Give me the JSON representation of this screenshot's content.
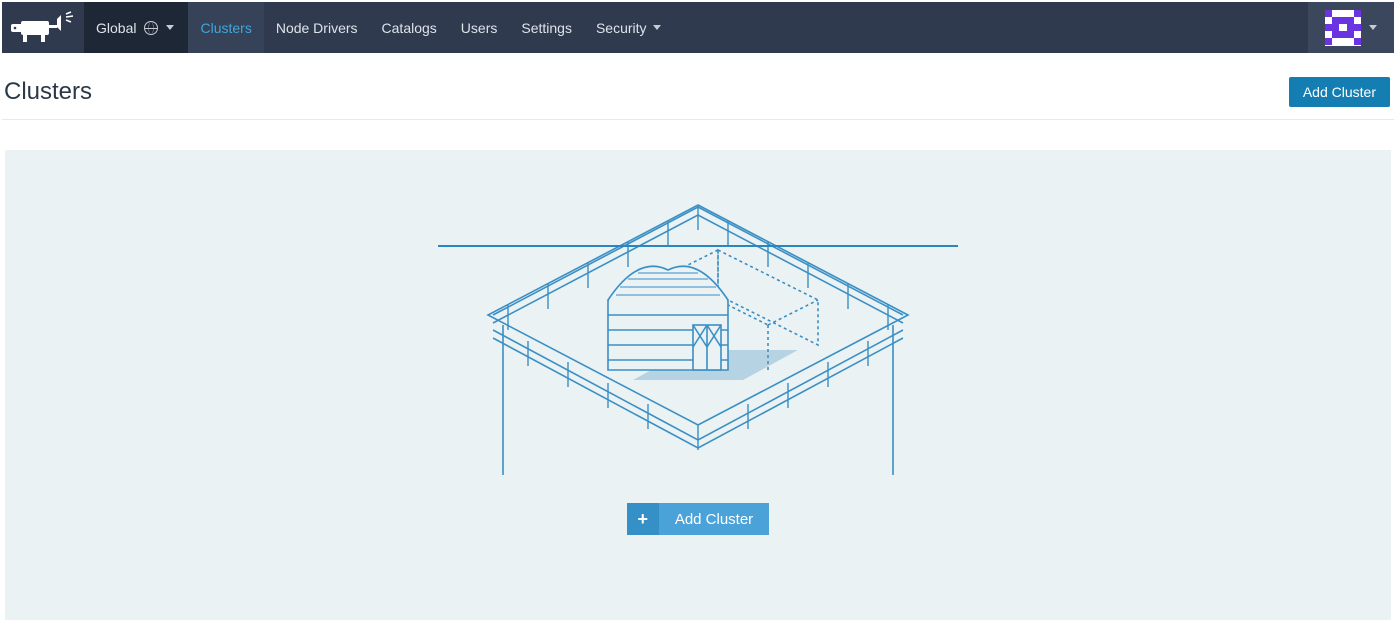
{
  "scope": {
    "label": "Global"
  },
  "nav": {
    "clusters": "Clusters",
    "node_drivers": "Node Drivers",
    "catalogs": "Catalogs",
    "users": "Users",
    "settings": "Settings",
    "security": "Security"
  },
  "page": {
    "title": "Clusters",
    "add_button": "Add Cluster"
  },
  "empty": {
    "add_button": "Add Cluster",
    "plus": "+"
  },
  "colors": {
    "accent": "#3ea6de",
    "topbar": "#2f3a4f",
    "primary_button": "#147db2"
  }
}
